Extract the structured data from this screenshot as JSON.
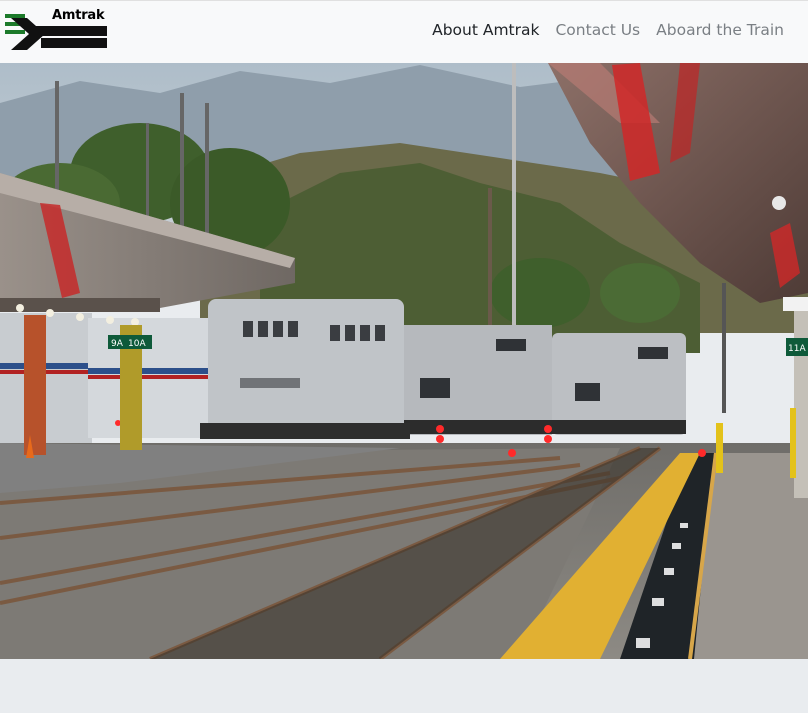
{
  "brand": {
    "name": "Amtrak"
  },
  "nav": {
    "items": [
      {
        "label": "About Amtrak",
        "active": true
      },
      {
        "label": "Contact Us",
        "active": false
      },
      {
        "label": "Aboard the Train",
        "active": false
      }
    ]
  },
  "hero": {
    "description": "Amtrak train at station platform",
    "signs": [
      "9A",
      "10A",
      "11A"
    ]
  },
  "colors": {
    "navbar_bg": "#f8f9fa",
    "brand_green": "#1c7a2a",
    "active_link": "#212529",
    "muted_link": "#7a7f84",
    "page_bg": "#e9ecef"
  }
}
